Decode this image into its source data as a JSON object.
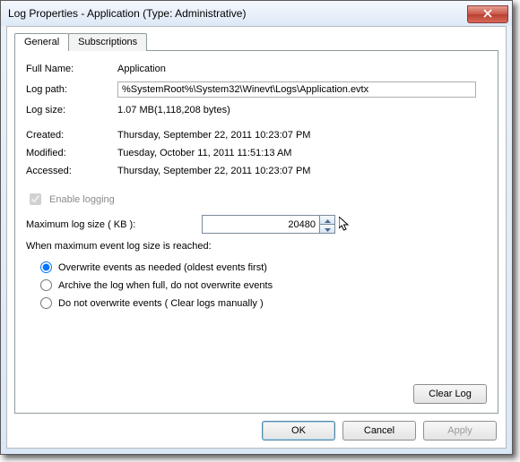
{
  "window": {
    "title": "Log Properties - Application (Type: Administrative)"
  },
  "tabs": [
    {
      "label": "General",
      "active": true
    },
    {
      "label": "Subscriptions",
      "active": false
    }
  ],
  "fields": {
    "full_name": {
      "label": "Full Name:",
      "value": "Application"
    },
    "log_path": {
      "label": "Log path:",
      "value": "%SystemRoot%\\System32\\Winevt\\Logs\\Application.evtx"
    },
    "log_size": {
      "label": "Log size:",
      "value": "1.07 MB(1,118,208 bytes)"
    },
    "created": {
      "label": "Created:",
      "value": "Thursday, September 22, 2011 10:23:07 PM"
    },
    "modified": {
      "label": "Modified:",
      "value": "Tuesday, October 11, 2011 11:51:13 AM"
    },
    "accessed": {
      "label": "Accessed:",
      "value": "Thursday, September 22, 2011 10:23:07 PM"
    }
  },
  "enable_logging": {
    "label": "Enable logging",
    "checked": true,
    "disabled": true
  },
  "max_size": {
    "label": "Maximum log size ( KB ):",
    "value": "20480"
  },
  "when_max": {
    "label": "When maximum event log size is reached:",
    "options": [
      "Overwrite events as needed (oldest events first)",
      "Archive the log when full, do not overwrite events",
      "Do not overwrite events ( Clear logs manually )"
    ],
    "selected": 0
  },
  "buttons": {
    "clear_log": "Clear Log",
    "ok": "OK",
    "cancel": "Cancel",
    "apply": "Apply"
  }
}
